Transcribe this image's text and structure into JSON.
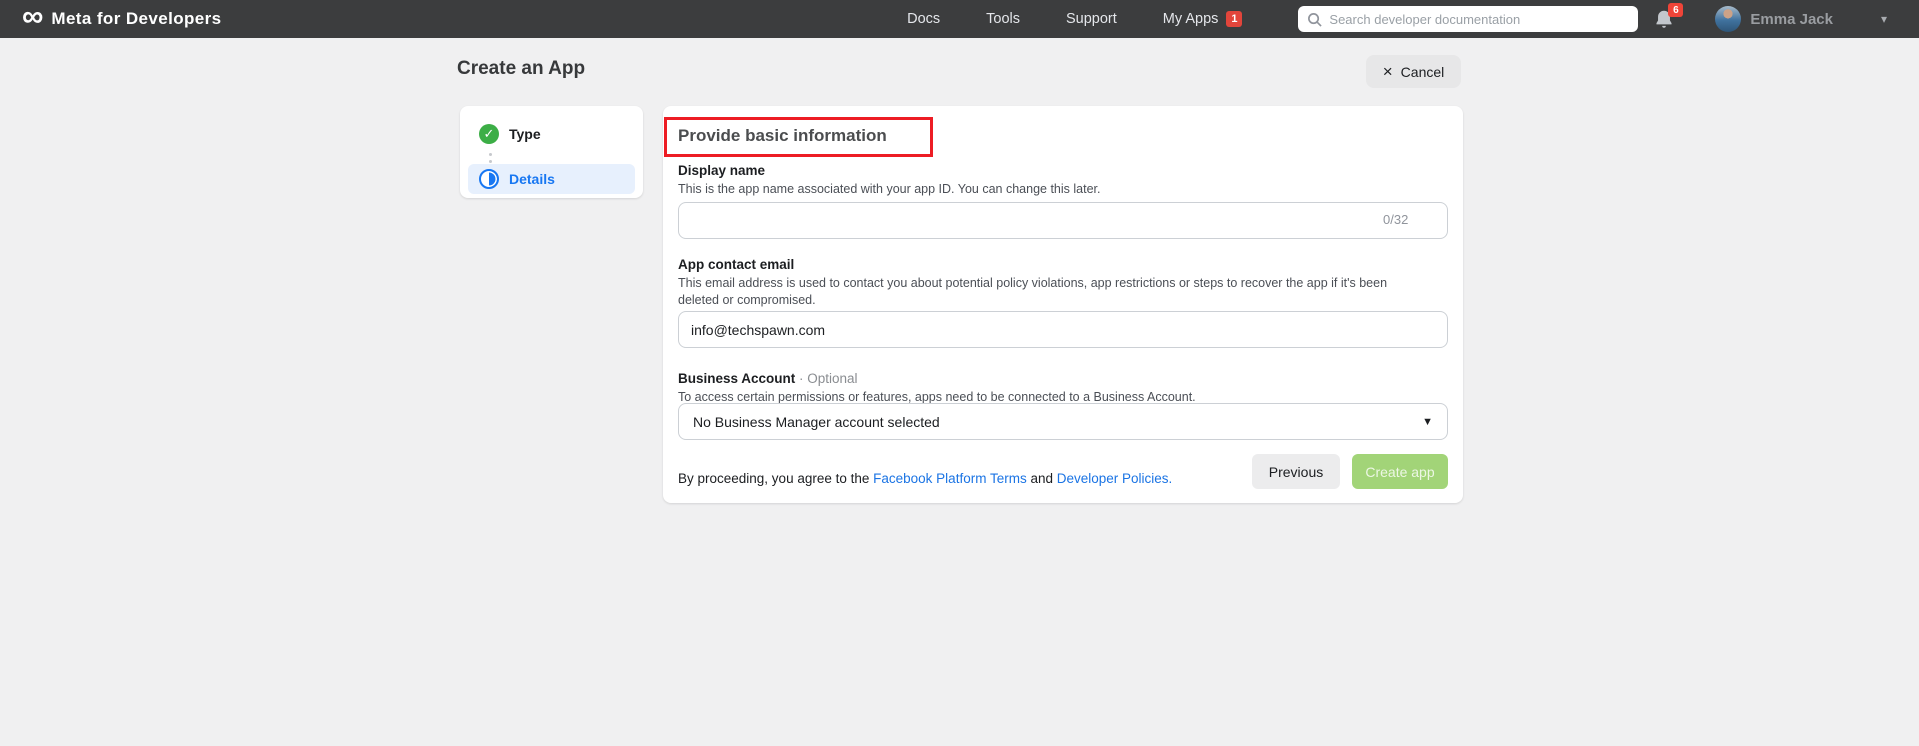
{
  "header": {
    "logo_text": "Meta for Developers",
    "nav": [
      {
        "label": "Docs"
      },
      {
        "label": "Tools"
      },
      {
        "label": "Support"
      },
      {
        "label": "My Apps",
        "badge": "1"
      }
    ],
    "search": {
      "placeholder": "Search developer documentation"
    },
    "notifications_count": "6",
    "user": {
      "name": "Emma Jack"
    }
  },
  "toolbar": {
    "title": "Create an App",
    "cancel_label": "Cancel"
  },
  "steps": {
    "items": [
      {
        "label": "Type",
        "state": "complete"
      },
      {
        "label": "Details",
        "state": "current"
      }
    ]
  },
  "form": {
    "heading": "Provide basic information",
    "display_name": {
      "label": "Display name",
      "help": "This is the app name associated with your app ID. You can change this later.",
      "value": "",
      "counter": "0/32"
    },
    "contact_email": {
      "label": "App contact email",
      "help": "This email address is used to contact you about potential policy violations, app restrictions or steps to recover the app if it's been deleted or compromised.",
      "value": "info@techspawn.com"
    },
    "business_account": {
      "label": "Business Account",
      "optional": " · Optional",
      "help": "To access certain permissions or features, apps need to be connected to a Business Account.",
      "value": "No Business Manager account selected"
    },
    "agreement": {
      "prefix": "By proceeding, you agree to the ",
      "terms_link": "Facebook Platform Terms",
      "middle": " and ",
      "policies_link": "Developer Policies."
    },
    "buttons": {
      "previous": "Previous",
      "create": "Create app"
    }
  },
  "colors": {
    "header_bg": "#3c3d3e",
    "accent_blue": "#1877f2",
    "link_blue": "#1b74e4",
    "success_green": "#3cae46",
    "create_button_green": "#a2d478",
    "annotation_red": "#ed1c24",
    "badge_red": "#e2453b",
    "selected_step_bg": "#e7f0fd"
  }
}
